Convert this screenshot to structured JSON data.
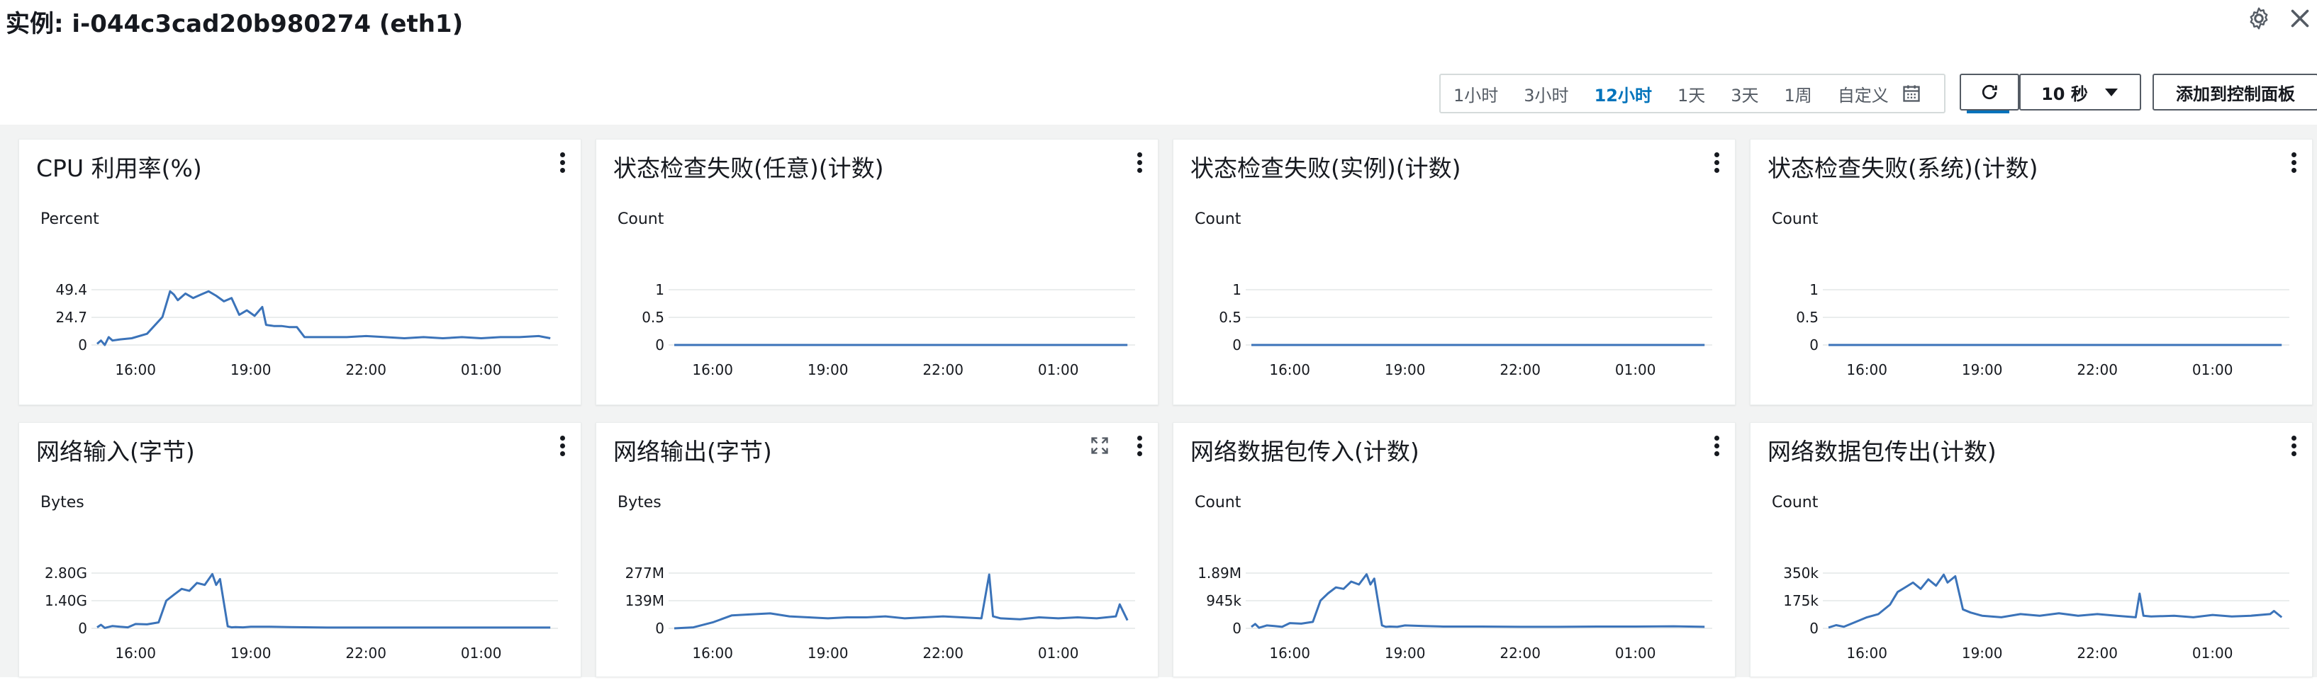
{
  "header": {
    "title": "实例: i-044c3cad20b980274 (eth1)"
  },
  "toolbar": {
    "ranges": [
      "1小时",
      "3小时",
      "12小时",
      "1天",
      "3天",
      "1周",
      "自定义"
    ],
    "active_range": "12小时",
    "refresh_interval": "10 秒",
    "add_to_dashboard": "添加到控制面板"
  },
  "icons": {
    "settings": "gear-icon",
    "close": "close-icon",
    "calendar": "calendar-icon",
    "refresh": "refresh-icon",
    "caret": "caret-down-icon",
    "menu": "kebab-menu-icon",
    "expand": "expand-icon"
  },
  "colors": {
    "series": "#3b73b9",
    "accent": "#0073bb",
    "grid_bg": "#f2f3f3"
  },
  "panels": [
    {
      "title": "CPU 利用率(%)",
      "unit": "Percent",
      "yticks": [
        "0",
        "24.7",
        "49.4"
      ],
      "xticks": [
        "16:00",
        "19:00",
        "22:00",
        "01:00"
      ],
      "expand": false
    },
    {
      "title": "状态检查失败(任意)(计数)",
      "unit": "Count",
      "yticks": [
        "0",
        "0.5",
        "1"
      ],
      "xticks": [
        "16:00",
        "19:00",
        "22:00",
        "01:00"
      ],
      "expand": false
    },
    {
      "title": "状态检查失败(实例)(计数)",
      "unit": "Count",
      "yticks": [
        "0",
        "0.5",
        "1"
      ],
      "xticks": [
        "16:00",
        "19:00",
        "22:00",
        "01:00"
      ],
      "expand": false
    },
    {
      "title": "状态检查失败(系统)(计数)",
      "unit": "Count",
      "yticks": [
        "0",
        "0.5",
        "1"
      ],
      "xticks": [
        "16:00",
        "19:00",
        "22:00",
        "01:00"
      ],
      "expand": false
    },
    {
      "title": "网络输入(字节)",
      "unit": "Bytes",
      "yticks": [
        "0",
        "1.40G",
        "2.80G"
      ],
      "xticks": [
        "16:00",
        "19:00",
        "22:00",
        "01:00"
      ],
      "expand": false
    },
    {
      "title": "网络输出(字节)",
      "unit": "Bytes",
      "yticks": [
        "0",
        "139M",
        "277M"
      ],
      "xticks": [
        "16:00",
        "19:00",
        "22:00",
        "01:00"
      ],
      "expand": true
    },
    {
      "title": "网络数据包传入(计数)",
      "unit": "Count",
      "yticks": [
        "0",
        "945k",
        "1.89M"
      ],
      "xticks": [
        "16:00",
        "19:00",
        "22:00",
        "01:00"
      ],
      "expand": false
    },
    {
      "title": "网络数据包传出(计数)",
      "unit": "Count",
      "yticks": [
        "0",
        "175k",
        "350k"
      ],
      "xticks": [
        "16:00",
        "19:00",
        "22:00",
        "01:00"
      ],
      "expand": false
    }
  ],
  "chart_data": [
    {
      "type": "line",
      "title": "CPU 利用率(%)",
      "ylabel": "Percent",
      "ylim": [
        0,
        49.4
      ],
      "x_ticks": [
        "16:00",
        "19:00",
        "22:00",
        "01:00"
      ],
      "x_hours": [
        15.0,
        27.0
      ],
      "x": [
        15.0,
        15.1,
        15.2,
        15.3,
        15.4,
        15.6,
        15.9,
        16.3,
        16.7,
        16.9,
        17.0,
        17.1,
        17.3,
        17.5,
        17.7,
        17.9,
        18.1,
        18.3,
        18.5,
        18.7,
        18.9,
        19.1,
        19.3,
        19.4,
        19.6,
        19.8,
        20.0,
        20.2,
        20.4,
        20.6,
        21.0,
        21.5,
        22.0,
        22.5,
        23.0,
        23.5,
        24.0,
        24.5,
        25.0,
        25.5,
        26.0,
        26.5,
        26.8
      ],
      "y": [
        1,
        4,
        0,
        7,
        4,
        5,
        6,
        10,
        25,
        48,
        45,
        40,
        46,
        42,
        45,
        48,
        44,
        39,
        42,
        27,
        31,
        26,
        34,
        18,
        17,
        17,
        16,
        16,
        7,
        7,
        7,
        7,
        8,
        7,
        6,
        7,
        6,
        7,
        6,
        7,
        7,
        8,
        6
      ]
    },
    {
      "type": "line",
      "title": "状态检查失败(任意)(计数)",
      "ylabel": "Count",
      "ylim": [
        0,
        1
      ],
      "x_ticks": [
        "16:00",
        "19:00",
        "22:00",
        "01:00"
      ],
      "x_hours": [
        15.0,
        27.0
      ],
      "x": [
        15.0,
        26.8
      ],
      "y": [
        0,
        0
      ]
    },
    {
      "type": "line",
      "title": "状态检查失败(实例)(计数)",
      "ylabel": "Count",
      "ylim": [
        0,
        1
      ],
      "x_ticks": [
        "16:00",
        "19:00",
        "22:00",
        "01:00"
      ],
      "x_hours": [
        15.0,
        27.0
      ],
      "x": [
        15.0,
        26.8
      ],
      "y": [
        0,
        0
      ]
    },
    {
      "type": "line",
      "title": "状态检查失败(系统)(计数)",
      "ylabel": "Count",
      "ylim": [
        0,
        1
      ],
      "x_ticks": [
        "16:00",
        "19:00",
        "22:00",
        "01:00"
      ],
      "x_hours": [
        15.0,
        27.0
      ],
      "x": [
        15.0,
        26.8
      ],
      "y": [
        0,
        0
      ]
    },
    {
      "type": "line",
      "title": "网络输入(字节)",
      "ylabel": "Bytes",
      "ylim": [
        0,
        2.8
      ],
      "x_ticks": [
        "16:00",
        "19:00",
        "22:00",
        "01:00"
      ],
      "x_hours": [
        15.0,
        27.0
      ],
      "x": [
        15.0,
        15.1,
        15.2,
        15.4,
        15.6,
        15.8,
        16.0,
        16.3,
        16.6,
        16.8,
        17.0,
        17.2,
        17.4,
        17.6,
        17.8,
        18.0,
        18.1,
        18.2,
        18.4,
        18.5,
        18.6,
        18.8,
        19.0,
        19.5,
        20.0,
        21.0,
        22.0,
        23.0,
        24.0,
        25.0,
        26.0,
        26.8
      ],
      "y": [
        0.05,
        0.18,
        0.02,
        0.12,
        0.08,
        0.05,
        0.22,
        0.2,
        0.3,
        1.4,
        1.7,
        2.0,
        1.9,
        2.3,
        2.2,
        2.75,
        2.2,
        2.5,
        0.1,
        0.05,
        0.06,
        0.05,
        0.08,
        0.08,
        0.06,
        0.04,
        0.04,
        0.04,
        0.04,
        0.04,
        0.04,
        0.04
      ]
    },
    {
      "type": "line",
      "title": "网络输出(字节)",
      "ylabel": "Bytes",
      "ylim": [
        0,
        277
      ],
      "x_ticks": [
        "16:00",
        "19:00",
        "22:00",
        "01:00"
      ],
      "x_hours": [
        15.0,
        27.0
      ],
      "x": [
        15.0,
        15.5,
        16.0,
        16.5,
        17.0,
        17.5,
        18.0,
        18.5,
        19.0,
        19.5,
        20.0,
        20.5,
        21.0,
        21.5,
        22.0,
        22.5,
        23.0,
        23.2,
        23.3,
        23.5,
        24.0,
        24.5,
        25.0,
        25.5,
        26.0,
        26.5,
        26.6,
        26.8
      ],
      "y": [
        0,
        5,
        30,
        65,
        70,
        75,
        60,
        55,
        50,
        55,
        55,
        60,
        50,
        55,
        60,
        55,
        50,
        270,
        60,
        50,
        45,
        55,
        50,
        55,
        50,
        60,
        120,
        40
      ]
    },
    {
      "type": "line",
      "title": "网络数据包传入(计数)",
      "ylabel": "Count",
      "ylim": [
        0,
        1.89
      ],
      "x_ticks": [
        "16:00",
        "19:00",
        "22:00",
        "01:00"
      ],
      "x_hours": [
        15.0,
        27.0
      ],
      "x": [
        15.0,
        15.1,
        15.2,
        15.4,
        15.6,
        15.8,
        16.0,
        16.3,
        16.6,
        16.8,
        17.0,
        17.2,
        17.4,
        17.6,
        17.8,
        18.0,
        18.1,
        18.2,
        18.4,
        18.5,
        18.6,
        18.8,
        19.0,
        19.5,
        20.0,
        21.0,
        22.0,
        23.0,
        24.0,
        25.0,
        26.0,
        26.8
      ],
      "y": [
        0.05,
        0.15,
        0.02,
        0.1,
        0.08,
        0.05,
        0.18,
        0.16,
        0.22,
        0.95,
        1.2,
        1.4,
        1.35,
        1.6,
        1.5,
        1.85,
        1.5,
        1.7,
        0.1,
        0.05,
        0.06,
        0.05,
        0.1,
        0.08,
        0.06,
        0.06,
        0.05,
        0.05,
        0.06,
        0.06,
        0.07,
        0.05
      ]
    },
    {
      "type": "line",
      "title": "网络数据包传出(计数)",
      "ylabel": "Count",
      "ylim": [
        0,
        350
      ],
      "x_ticks": [
        "16:00",
        "19:00",
        "22:00",
        "01:00"
      ],
      "x_hours": [
        15.0,
        27.0
      ],
      "x": [
        15.0,
        15.2,
        15.4,
        15.7,
        16.0,
        16.3,
        16.6,
        16.8,
        17.0,
        17.2,
        17.4,
        17.6,
        17.8,
        18.0,
        18.1,
        18.3,
        18.5,
        18.7,
        19.0,
        19.5,
        20.0,
        20.5,
        21.0,
        21.5,
        22.0,
        22.5,
        23.0,
        23.1,
        23.2,
        23.4,
        24.0,
        24.5,
        25.0,
        25.5,
        26.0,
        26.5,
        26.6,
        26.8
      ],
      "y": [
        5,
        20,
        10,
        40,
        70,
        90,
        150,
        230,
        260,
        290,
        250,
        310,
        270,
        340,
        290,
        330,
        120,
        100,
        80,
        70,
        90,
        80,
        95,
        80,
        90,
        80,
        70,
        220,
        80,
        75,
        80,
        70,
        85,
        75,
        80,
        90,
        110,
        70
      ]
    }
  ]
}
